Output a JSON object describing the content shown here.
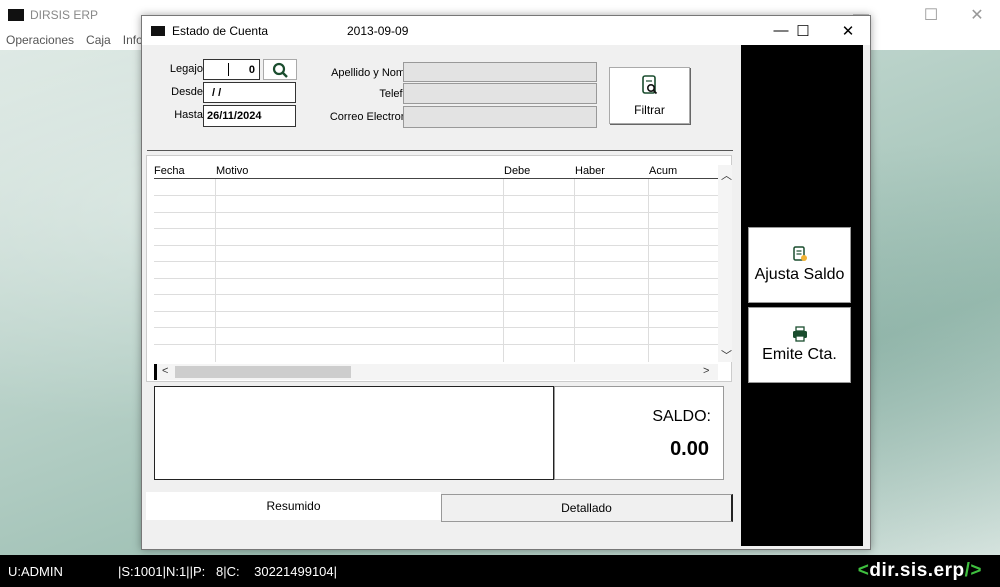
{
  "app": {
    "title": "DIRSIS ERP",
    "menu": [
      "Operaciones",
      "Caja",
      "Info"
    ]
  },
  "dialog": {
    "title": "Estado de Cuenta",
    "date": "2013-09-09",
    "legajo_label": "Legajo:",
    "legajo_value": "0",
    "desde_label": "Desde:",
    "desde_value": "/ /",
    "hasta_label": "Hasta:",
    "hasta_value": "26/11/2024",
    "apellido_label": "Apellido y Nombre:",
    "telefono_label": "Telefono:",
    "correo_label": "Correo Electronico:",
    "filtrar_label": "Filtrar",
    "columns": [
      "Fecha",
      "Motivo",
      "Debe",
      "Haber",
      "Acum"
    ],
    "saldo_label": "SALDO:",
    "saldo_value": "0.00",
    "tabs": [
      "Resumido",
      "Detallado"
    ],
    "ajusta_saldo_label": "Ajusta Saldo",
    "emite_cta_label": "Emite Cta."
  },
  "status": {
    "user": "U:ADMIN",
    "info": "|S:1001|N:1||P:   8|C:    30221499104|",
    "brand_open": "<",
    "brand_text": "dir.sis.erp",
    "brand_close": "/>"
  },
  "colors": {
    "accent_green": "#3fbf3f",
    "panel_black": "#000000"
  }
}
